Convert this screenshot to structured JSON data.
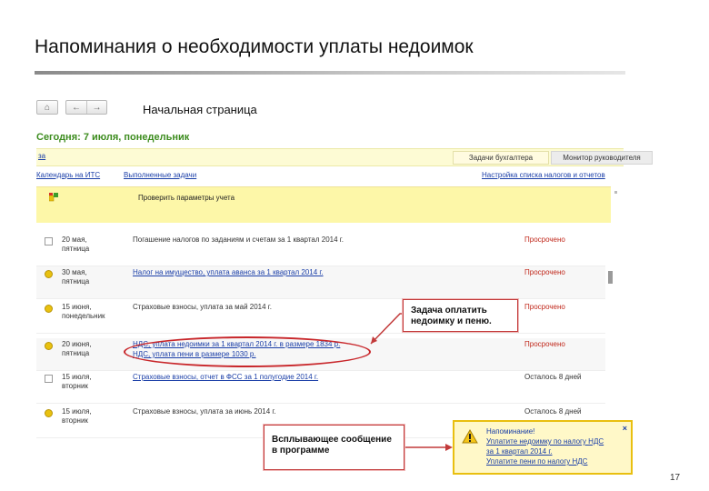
{
  "slide": {
    "title": "Напоминания о необходимости уплаты недоимок",
    "page_number": "17"
  },
  "app": {
    "page_heading": "Начальная страница",
    "today_label": "Сегодня: 7 июля, понедельник",
    "band_link": "за",
    "tabs": [
      "Задачи бухгалтера",
      "Монитор руководителя"
    ],
    "links": [
      "Календарь на ИТС",
      "Выполненные задачи",
      "Настройка списка налогов и отчетов"
    ],
    "check_item": "Проверить параметры учета",
    "rows": [
      {
        "date_line1": "20 мая,",
        "date_line2": "пятница",
        "title": "Погашение налогов по заданиям и счетам за 1 квартал 2014 г.",
        "title2": "",
        "status": "Просрочено",
        "icon": "doc"
      },
      {
        "date_line1": "30 мая,",
        "date_line2": "пятница",
        "title": "Налог на имущество, уплата аванса за 1 квартал 2014 г.",
        "title2": "",
        "status": "Просрочено",
        "icon": "task"
      },
      {
        "date_line1": "15 июня,",
        "date_line2": "понедельник",
        "title": "Страховые взносы, уплата за май 2014 г.",
        "title2": "",
        "status": "Просрочено",
        "icon": "task"
      },
      {
        "date_line1": "20 июня,",
        "date_line2": "пятница",
        "title": "НДС, уплата недоимки за 1 квартал 2014 г. в размере 1834 р.",
        "title2": "НДС, уплата пени в размере 1030 р.",
        "status": "Просрочено",
        "icon": "task"
      },
      {
        "date_line1": "15 июля,",
        "date_line2": "вторник",
        "title": "Страховые взносы, отчет в ФСС за 1 полугодие 2014 г.",
        "title2": "",
        "status": "Осталось 8 дней",
        "icon": "doc"
      },
      {
        "date_line1": "15 июля,",
        "date_line2": "вторник",
        "title": "Страховые взносы, уплата за июнь 2014 г.",
        "title2": "",
        "status": "Осталось 8 дней",
        "icon": "task"
      }
    ]
  },
  "callouts": {
    "task": "Задача оплатить недоимку и пеню.",
    "popup": "Всплывающее сообщение в программе"
  },
  "notification": {
    "close": "×",
    "heading": "Напоминание!",
    "lines": [
      "Уплатите недоимку по налогу НДС",
      "за 1 квартал 2014 г.",
      "Уплатите пени по налогу НДС"
    ]
  },
  "colors": {
    "today_green": "#3c8c1e",
    "link_blue": "#1b3fa8",
    "overdue_red": "#c0271a",
    "band_yellow": "#fdf7a8",
    "highlight_red": "#c8262a",
    "notify_border": "#e9bf10"
  },
  "icons": {
    "home": "home-icon",
    "back": "arrow-left-icon",
    "forward": "arrow-right-icon",
    "warning": "warning-icon"
  }
}
